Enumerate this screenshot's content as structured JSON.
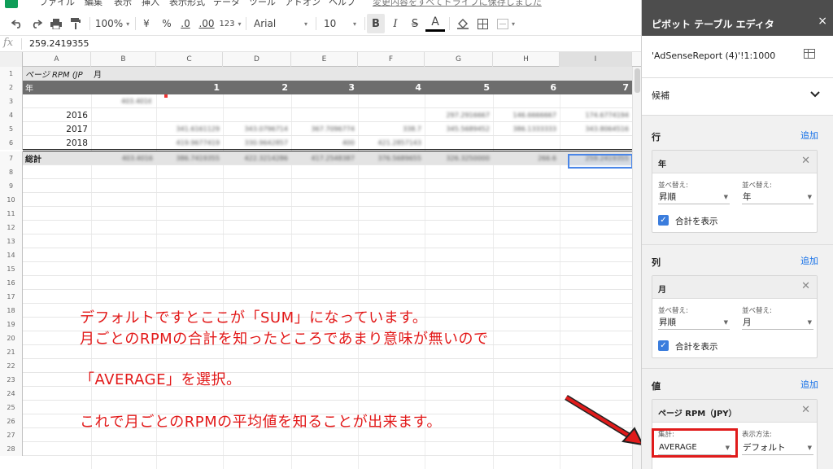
{
  "menubar": {
    "items": [
      "ファイル",
      "編集",
      "表示",
      "挿入",
      "表示形式",
      "データ",
      "ツール",
      "アドオン",
      "ヘルプ"
    ],
    "save_status": "変更内容をすべてドライブに保存しました"
  },
  "toolbar": {
    "zoom": "100%",
    "currency": "¥",
    "percent": "%",
    "decimal_less": ".0",
    "decimal_more": ".00",
    "more_formats": "123",
    "font": "Arial",
    "font_size": "10",
    "bold": "B",
    "italic": "I",
    "strike": "S",
    "text_color": "A"
  },
  "formula_bar": {
    "fx": "fx",
    "value": "259.2419355"
  },
  "grid": {
    "columns": [
      "A",
      "B",
      "C",
      "D",
      "E",
      "F",
      "G",
      "H",
      "I"
    ],
    "row_numbers": [
      "1",
      "2",
      "3",
      "4",
      "5",
      "6",
      "7",
      "8",
      "9",
      "10",
      "11",
      "12",
      "13",
      "14",
      "15",
      "16",
      "17",
      "18",
      "19",
      "20",
      "21",
      "22",
      "23",
      "24",
      "25",
      "26",
      "27",
      "28"
    ],
    "r1_a": "ページ RPM (JP",
    "r1_b": "月",
    "r2_a": "年",
    "months": [
      "1",
      "2",
      "3",
      "4",
      "5",
      "6",
      "7"
    ],
    "years": [
      "2016",
      "2017",
      "2018"
    ],
    "total_label": "総計"
  },
  "blurred": {
    "r3_b": "403.4016",
    "r4": [
      "297.2916667",
      "146.6666667",
      "174.6774194"
    ],
    "r5": [
      "341.6161129",
      "343.0796714",
      "367.7096774",
      "338.7",
      "345.5689452",
      "386.1333333",
      "343.8064516"
    ],
    "r6": [
      "419.9677419",
      "330.9642857",
      "400",
      "421.2857143"
    ],
    "r7": [
      "403.4016",
      "386.7419355",
      "422.3214286",
      "417.2548387",
      "376.5689655",
      "326.3250000",
      "266.6",
      "259.2419355"
    ]
  },
  "annotation": {
    "line1": "デフォルトですとここが「SUM」になっています。",
    "line2": "月ごとのRPMの合計を知ったところであまり意味が無いので",
    "line3": "「AVERAGE」を選択。",
    "line4": "これで月ごとのRPMの平均値を知ることが出来ます。",
    "color": "#e21818"
  },
  "panel": {
    "title": "ピボット テーブル エディタ",
    "close": "×",
    "range": "'AdSenseReport (4)'!1:1000",
    "suggest": "候補",
    "rows_label": "行",
    "cols_label": "列",
    "values_label": "値",
    "add": "追加",
    "row_card": {
      "title": "年",
      "sort_label": "並べ替え:",
      "sort_value": "昇順",
      "by_label": "並べ替え:",
      "by_value": "年",
      "show_totals": "合計を表示"
    },
    "col_card": {
      "title": "月",
      "sort_label": "並べ替え:",
      "sort_value": "昇順",
      "by_label": "並べ替え:",
      "by_value": "月",
      "show_totals": "合計を表示"
    },
    "val_card": {
      "title": "ページ RPM（JPY）",
      "summarize_label": "集計:",
      "summarize_value": "AVERAGE",
      "show_as_label": "表示方法:",
      "show_as_value": "デフォルト"
    }
  }
}
